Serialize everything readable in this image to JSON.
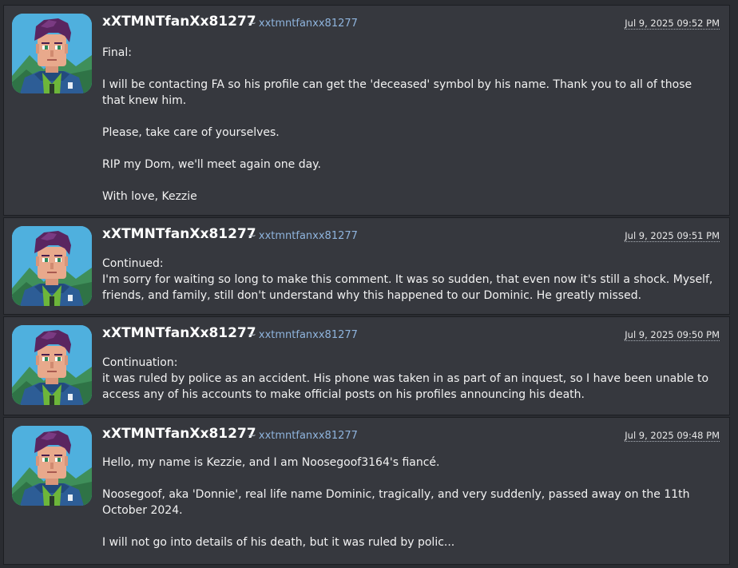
{
  "comments": [
    {
      "username": "xXTMNTfanXx81277",
      "handle_prefix": "~",
      "handle": "xxtmntfanxx81277",
      "timestamp": "Jul 9, 2025 09:52 PM",
      "paragraphs": [
        "Final:",
        "I will be contacting FA so his profile can get the 'deceased' symbol by his name. Thank you to all of those that knew him.",
        "Please, take care of yourselves.",
        "RIP my Dom, we'll meet again one day.",
        "With love, Kezzie"
      ]
    },
    {
      "username": "xXTMNTfanXx81277",
      "handle_prefix": "~",
      "handle": "xxtmntfanxx81277",
      "timestamp": "Jul 9, 2025 09:51 PM",
      "paragraphs": [
        "Continued:",
        "I'm sorry for waiting so long to make this comment. It was so sudden, that even now it's still a shock. Myself, friends, and family, still don't understand why this happened to our Dominic. He greatly missed."
      ]
    },
    {
      "username": "xXTMNTfanXx81277",
      "handle_prefix": "~",
      "handle": "xxtmntfanxx81277",
      "timestamp": "Jul 9, 2025 09:50 PM",
      "paragraphs": [
        "Continuation:",
        "it was ruled by police as an accident. His phone was taken in as part of an inquest, so I have been unable to access any of his accounts to make official posts on his profiles announcing his death."
      ]
    },
    {
      "username": "xXTMNTfanXx81277",
      "handle_prefix": "~",
      "handle": "xxtmntfanxx81277",
      "timestamp": "Jul 9, 2025 09:48 PM",
      "paragraphs": [
        "Hello, my name is Kezzie, and I am Noosegoof3164's fiancé.",
        "Noosegoof, aka 'Donnie', real life name Dominic, tragically, and very suddenly, passed away on the 11th October 2024.",
        "I will not go into details of his death, but it was ruled by polic..."
      ]
    }
  ],
  "avatar_icon": "pixel-art-avatar-icon"
}
